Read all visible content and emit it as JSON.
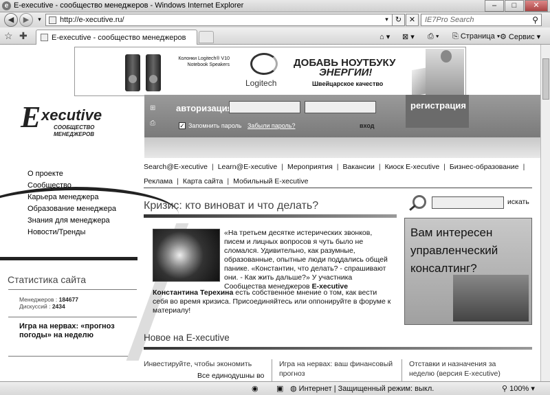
{
  "browser": {
    "title": "E-executive - сообщество менеджеров - Windows Internet Explorer",
    "address": "http://e-xecutive.ru/",
    "search_placeholder": "IE7Pro Search",
    "tab_label": "E-executive - сообщество менеджеров",
    "cmd_page": "Страница",
    "cmd_service": "Сервис",
    "status_internet": "Интернет | Защищенный режим: выкл.",
    "zoom": "100%"
  },
  "banner": {
    "product_desc": "Колонки Logitech® V10 Notebook Speakers",
    "brand": "Logitech",
    "headline1": "ДОБАВЬ НОУТБУКУ",
    "headline2": "ЭНЕРГИИ!",
    "tagline": "Швейцарское качество"
  },
  "logo": {
    "mark": "E",
    "word": "xecutive",
    "sub1": "СООБЩЕСТВО",
    "sub2": "МЕНЕДЖЕРОВ"
  },
  "auth": {
    "label": "авторизация",
    "remember": "Запомнить пароль",
    "forgot": "Забыли пароль?",
    "login": "вход",
    "register": "регистрация"
  },
  "leftnav": [
    "О проекте",
    "Сообщество",
    "Карьера менеджера",
    "Образование менеджера",
    "Знания для менеджера",
    "Новости/Тренды"
  ],
  "stats": {
    "title": "Статистика сайта",
    "managers_label": "Менеджеров :",
    "managers": "184677",
    "discussions_label": "Дискуссий :",
    "discussions": "2434"
  },
  "side_news": "Игра на нервах: «прогноз погоды» на неделю",
  "topmenu_row1": [
    "Search@E-xecutive",
    "Learn@E-xecutive",
    "Мероприятия",
    "Вакансии",
    "Киоск E-xecutive",
    "Бизнес-образование"
  ],
  "topmenu_row2": [
    "Реклама",
    "Карта сайта",
    "Мобильный E-xecutive"
  ],
  "main": {
    "headline": "Кризис: кто виноват и что делать?",
    "article_p1": "«На третьем десятке истерических звонков, писем и лиц­ных вопросов я чуть было не сломался. Удивительно, как разумные, образованные, опытные люди поддались общей панике. «Константин, что делать? - спрашивают они. - Как жить дальше?» У участника Сообщества менеджеров",
    "article_brand": "E-xecutive",
    "article_author": "Константина Терехина",
    "article_p2": "есть собственное мнение о том, как вести себя во время кризиса. Присоединяйтесь или оппонируйте в форуме к материалу!",
    "search_button": "искать",
    "ad_text": "Вам интересен управленческий консалтинг?",
    "new_heading": "Новое на E-xecutive",
    "col1_title": "Инвестируйте, чтобы экономить",
    "col1_text": "Все единодушны во",
    "col2_title": "Игра на нервах: ваш финансовый прогноз",
    "col3_title": "Отставки и назначения за неделю (версия E-xecutive)"
  }
}
